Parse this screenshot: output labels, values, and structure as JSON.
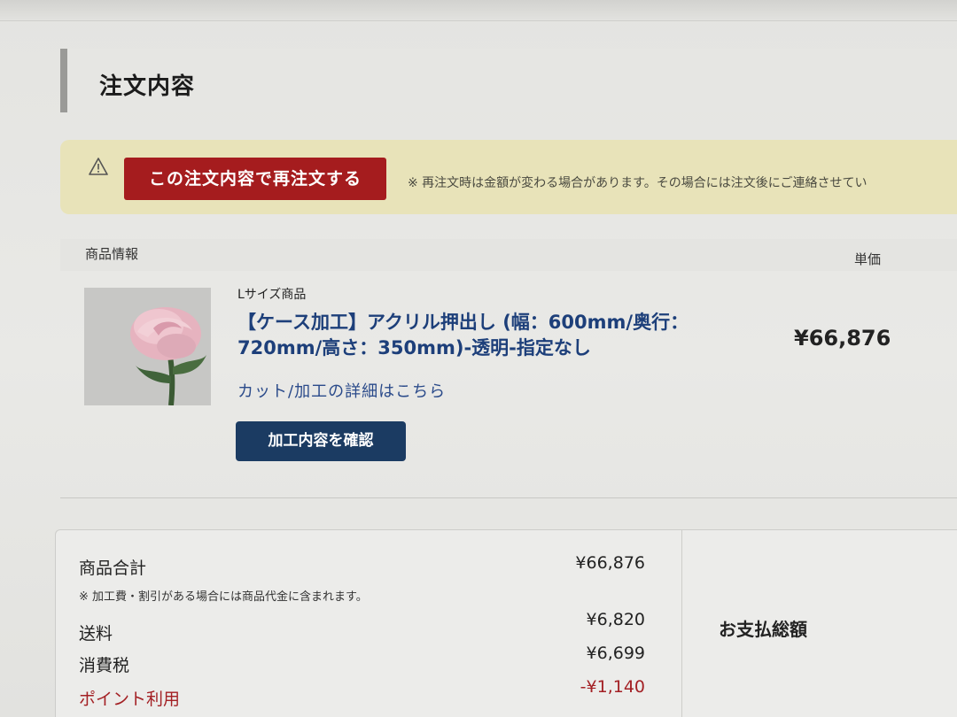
{
  "section": {
    "title": "注文内容"
  },
  "notice": {
    "icon": "warning-icon",
    "reorder_label": "この注文内容で再注文する",
    "text": "※ 再注文時は金額が変わる場合があります。その場合には注文後にご連絡させてい"
  },
  "columns": {
    "product": "商品情報",
    "unit_price": "単価"
  },
  "item": {
    "size_label": "Lサイズ商品",
    "name": "【ケース加工】アクリル押出し (幅：600mm/奥行：720mm/高さ：350mm)-透明-指定なし",
    "detail_link": "カット/加工の詳細はこちら",
    "confirm_label": "加工内容を確認",
    "unit_price": "¥66,876"
  },
  "summary": {
    "subtotal_label": "商品合計",
    "subtotal_value": "¥66,876",
    "note": "※ 加工費・割引がある場合には商品代金に含まれます。",
    "shipping_label": "送料",
    "shipping_value": "¥6,820",
    "tax_label": "消費税",
    "tax_value": "¥6,699",
    "points_label": "ポイント利用",
    "points_value": "-¥1,140",
    "total_label": "お支払総額"
  },
  "colors": {
    "reorder_button": "#a51c1e",
    "confirm_button": "#1b3b62",
    "product_link": "#1d3f7a",
    "notice_bg": "#e8e3b9",
    "points": "#a32024"
  }
}
